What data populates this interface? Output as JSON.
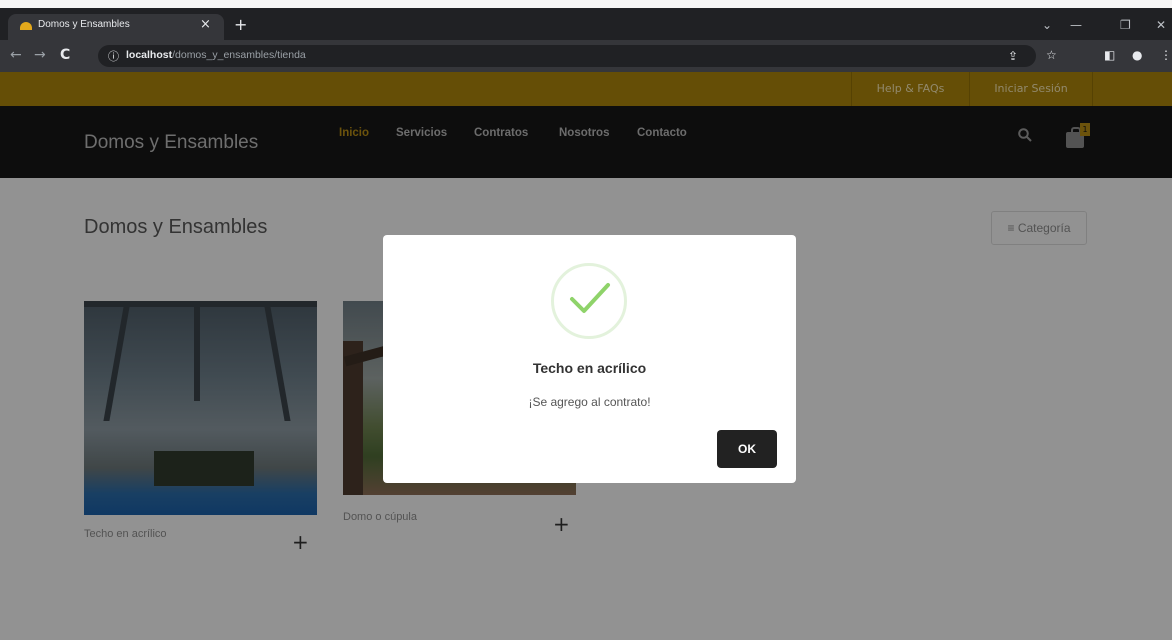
{
  "browser": {
    "tab_title": "Domos y Ensambles",
    "tab_close": "×",
    "new_tab": "+",
    "url_info_icon": "ⓘ",
    "url_host": "localhost",
    "url_path": "/domos_y_ensambles/tienda",
    "window_controls": [
      "⌄",
      "—",
      "❐",
      "✕"
    ],
    "toolbar_icons": [
      "share-icon",
      "star-icon",
      "sidepanel-icon",
      "profile-icon",
      "menu-icon"
    ],
    "toolbar_glyphs": [
      "⇪",
      "☆",
      "◧",
      "●",
      "⋮"
    ],
    "nav_back": "←",
    "nav_forward": "→",
    "nav_reload": "C"
  },
  "topbar": {
    "links": [
      "Help & FAQs",
      "Iniciar Sesión"
    ]
  },
  "header": {
    "brand": "Domos y Ensambles",
    "nav": [
      "Inicio",
      "Servicios",
      "Contratos",
      "Nosotros",
      "Contacto"
    ],
    "active_nav": "Inicio",
    "cart_count": "1"
  },
  "main": {
    "title": "Domos y Ensambles",
    "category_button": "Categoría",
    "products": [
      {
        "name": "Techo en acrílico",
        "add": "+"
      },
      {
        "name": "Domo o cúpula",
        "add": "+"
      }
    ]
  },
  "modal": {
    "icon": "success-check-icon",
    "title": "Techo en acrílico",
    "message": "¡Se agrego al contrato!",
    "ok_label": "OK"
  },
  "colors": {
    "accent": "#b48a14",
    "topbar": "#a8830b",
    "header_bg": "#161616",
    "success_green": "#8fd36a"
  }
}
